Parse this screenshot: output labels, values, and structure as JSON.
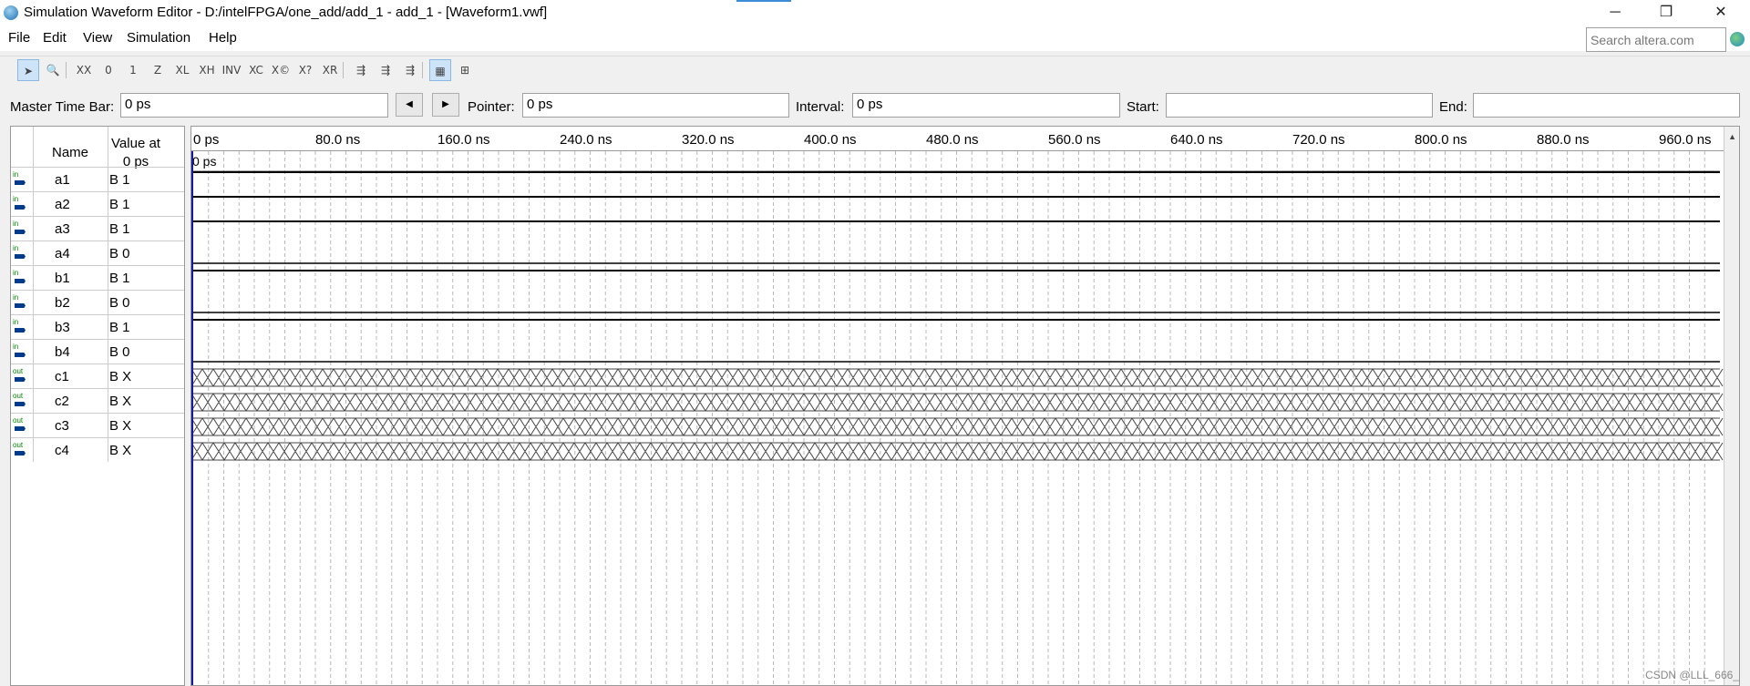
{
  "window": {
    "title": "Simulation Waveform Editor - D:/intelFPGA/one_add/add_1 - add_1 - [Waveform1.vwf]",
    "minimize": "─",
    "restore": "❐",
    "close": "✕"
  },
  "menu": [
    "File",
    "Edit",
    "View",
    "Simulation",
    "Help"
  ],
  "search": {
    "placeholder": "Search altera.com",
    "value": ""
  },
  "toolbar": [
    {
      "name": "selection-tool-icon",
      "glyph": "➤",
      "active": true
    },
    {
      "name": "zoom-tool-icon",
      "glyph": "🔍",
      "active": false
    },
    {
      "name": "waveform-x-icon",
      "glyph": "XX"
    },
    {
      "name": "waveform-0-icon",
      "glyph": "0"
    },
    {
      "name": "waveform-1-icon",
      "glyph": "1"
    },
    {
      "name": "waveform-z-icon",
      "glyph": "Z"
    },
    {
      "name": "waveform-l-icon",
      "glyph": "XL"
    },
    {
      "name": "waveform-h-icon",
      "glyph": "XH"
    },
    {
      "name": "invert-icon",
      "glyph": "INV"
    },
    {
      "name": "count-value-icon",
      "glyph": "XC"
    },
    {
      "name": "clock-icon",
      "glyph": "X©"
    },
    {
      "name": "arbitrary-value-icon",
      "glyph": "X?"
    },
    {
      "name": "random-value-icon",
      "glyph": "XR"
    },
    {
      "name": "functional-sim-icon",
      "glyph": "⇶"
    },
    {
      "name": "timing-sim-icon",
      "glyph": "⇶"
    },
    {
      "name": "netlist-sim-icon",
      "glyph": "⇶"
    },
    {
      "name": "snap-grid-icon",
      "glyph": "▦",
      "active": true
    },
    {
      "name": "sort-icon",
      "glyph": "⊞"
    }
  ],
  "timebar": {
    "master_label": "Master Time Bar:",
    "master_value": "0 ps",
    "pointer_label": "Pointer:",
    "pointer_value": "0 ps",
    "interval_label": "Interval:",
    "interval_value": "0 ps",
    "start_label": "Start:",
    "start_value": "",
    "end_label": "End:",
    "end_value": ""
  },
  "table": {
    "name_header": "Name",
    "value_header": "Value at\n0 ps"
  },
  "signals": [
    {
      "name": "a1",
      "dir": "in",
      "value": "B 1",
      "level": 1
    },
    {
      "name": "a2",
      "dir": "in",
      "value": "B 1",
      "level": 1
    },
    {
      "name": "a3",
      "dir": "in",
      "value": "B 1",
      "level": 1
    },
    {
      "name": "a4",
      "dir": "in",
      "value": "B 0",
      "level": 0
    },
    {
      "name": "b1",
      "dir": "in",
      "value": "B 1",
      "level": 1
    },
    {
      "name": "b2",
      "dir": "in",
      "value": "B 0",
      "level": 0
    },
    {
      "name": "b3",
      "dir": "in",
      "value": "B 1",
      "level": 1
    },
    {
      "name": "b4",
      "dir": "in",
      "value": "B 0",
      "level": 0
    },
    {
      "name": "c1",
      "dir": "out",
      "value": "B X",
      "level": "X"
    },
    {
      "name": "c2",
      "dir": "out",
      "value": "B X",
      "level": "X"
    },
    {
      "name": "c3",
      "dir": "out",
      "value": "B X",
      "level": "X"
    },
    {
      "name": "c4",
      "dir": "out",
      "value": "B X",
      "level": "X"
    }
  ],
  "ruler": [
    "0 ps",
    "80.0 ns",
    "160.0 ns",
    "240.0 ns",
    "320.0 ns",
    "400.0 ns",
    "480.0 ns",
    "560.0 ns",
    "640.0 ns",
    "720.0 ns",
    "800.0 ns",
    "880.0 ns",
    "960.0 ns"
  ],
  "cursor_label": "0 ps",
  "watermark": "CSDN @LLL_666_",
  "colors": {
    "cursor": "#1a1aa0",
    "grid": "#b8b8b8",
    "wave": "#000000",
    "in_label": "#008000"
  }
}
